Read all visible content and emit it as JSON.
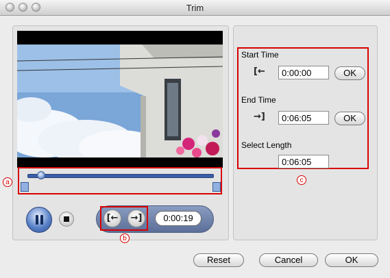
{
  "window": {
    "title": "Trim"
  },
  "callouts": {
    "a": "a",
    "b": "b",
    "c": "c"
  },
  "player": {
    "current_time": "0:00:19",
    "play_state": "paused",
    "progress_fraction": 0.07
  },
  "fields": {
    "start_time": {
      "label": "Start Time",
      "value": "0:00:00",
      "ok_label": "OK",
      "icon": "set-start-icon"
    },
    "end_time": {
      "label": "End Time",
      "value": "0:06:05",
      "ok_label": "OK",
      "icon": "set-end-icon"
    },
    "select_length": {
      "label": "Select Length",
      "value": "0:06:05"
    }
  },
  "mark_buttons": {
    "start_glyph": "[←",
    "end_glyph": "→]"
  },
  "footer": {
    "reset_label": "Reset",
    "cancel_label": "Cancel",
    "ok_label": "OK"
  },
  "colors": {
    "highlight": "#d90000",
    "slider_track": "#3b5fa8"
  }
}
